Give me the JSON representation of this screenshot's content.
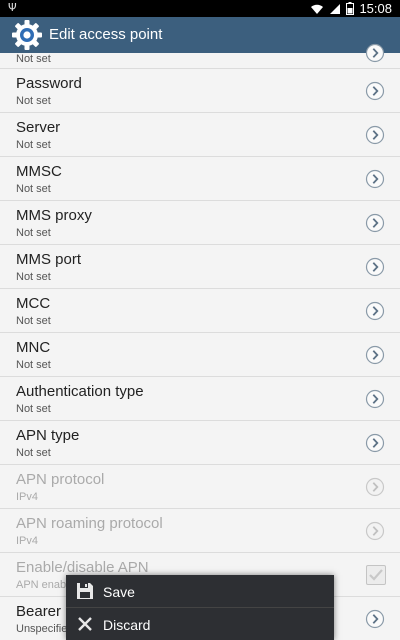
{
  "status_bar": {
    "usb_icon": "usb-icon",
    "wifi_icon": "wifi-icon",
    "signal_icon": "signal-icon",
    "battery_icon": "battery-icon",
    "time": "15:08"
  },
  "action_bar": {
    "icon": "settings-gear-icon",
    "title": "Edit access point"
  },
  "items": {
    "proxy_partial": {
      "summary": "Not set"
    },
    "password": {
      "title": "Password",
      "summary": "Not set"
    },
    "server": {
      "title": "Server",
      "summary": "Not set"
    },
    "mmsc": {
      "title": "MMSC",
      "summary": "Not set"
    },
    "mms_proxy": {
      "title": "MMS proxy",
      "summary": "Not set"
    },
    "mms_port": {
      "title": "MMS port",
      "summary": "Not set"
    },
    "mcc": {
      "title": "MCC",
      "summary": "Not set"
    },
    "mnc": {
      "title": "MNC",
      "summary": "Not set"
    },
    "auth_type": {
      "title": "Authentication type",
      "summary": "Not set"
    },
    "apn_type": {
      "title": "APN type",
      "summary": "Not set"
    },
    "apn_protocol": {
      "title": "APN protocol",
      "summary": "IPv4"
    },
    "apn_roaming_protocol": {
      "title": "APN roaming protocol",
      "summary": "IPv4"
    },
    "enable_apn": {
      "title": "Enable/disable APN",
      "summary": "APN enab",
      "checked": true
    },
    "bearer": {
      "title": "Bearer",
      "summary": "Unspecifie"
    }
  },
  "menu": {
    "save_label": "Save",
    "save_icon": "save-icon",
    "discard_label": "Discard",
    "discard_icon": "close-icon"
  },
  "colors": {
    "action_bar": "#3c5f7e",
    "background": "#f4f4f4",
    "menu": "#2d2f33"
  }
}
